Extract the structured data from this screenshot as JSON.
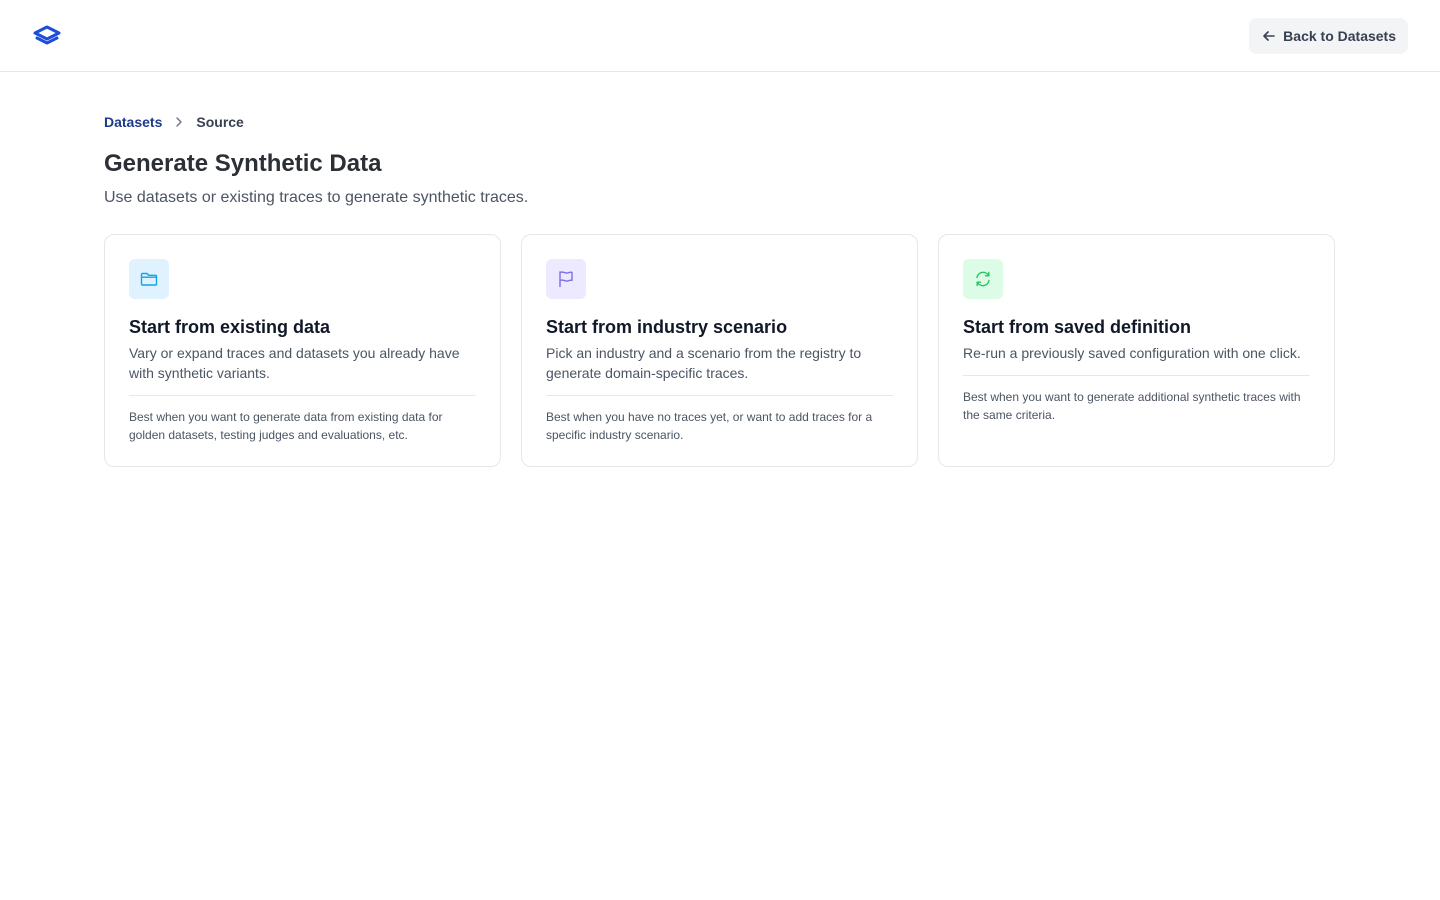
{
  "header": {
    "back_label": "Back to Datasets",
    "logo_icon": "layers-icon",
    "back_icon": "arrow-left-icon"
  },
  "breadcrumb": {
    "items": [
      "Datasets",
      "Source"
    ]
  },
  "page": {
    "title": "Generate Synthetic Data",
    "subtitle": "Use datasets or existing traces to generate synthetic traces."
  },
  "cards": [
    {
      "icon": "folder-icon",
      "accent": "#0ea5e9",
      "accent_bg": "#e0f2fe",
      "title": "Start from existing data",
      "description": "Vary or expand traces and datasets you already have with synthetic variants.",
      "note": "Best when you want to generate data from existing data for golden datasets, testing judges and evaluations, etc."
    },
    {
      "icon": "flag-icon",
      "accent": "#7c6fe0",
      "accent_bg": "#ede9fe",
      "title": "Start from industry scenario",
      "description": "Pick an industry and a scenario from the registry to generate domain-specific traces.",
      "note": "Best when you have no traces yet, or want to add traces for a specific industry scenario."
    },
    {
      "icon": "refresh-icon",
      "accent": "#22c55e",
      "accent_bg": "#dcfce7",
      "title": "Start from saved definition",
      "description": "Re-run a previously saved configuration with one click.",
      "note": "Best when you want to generate additional synthetic traces with the same criteria."
    }
  ],
  "colors": {
    "brand": "#1d4ed8",
    "breadcrumb_link": "#1e3a8a"
  }
}
